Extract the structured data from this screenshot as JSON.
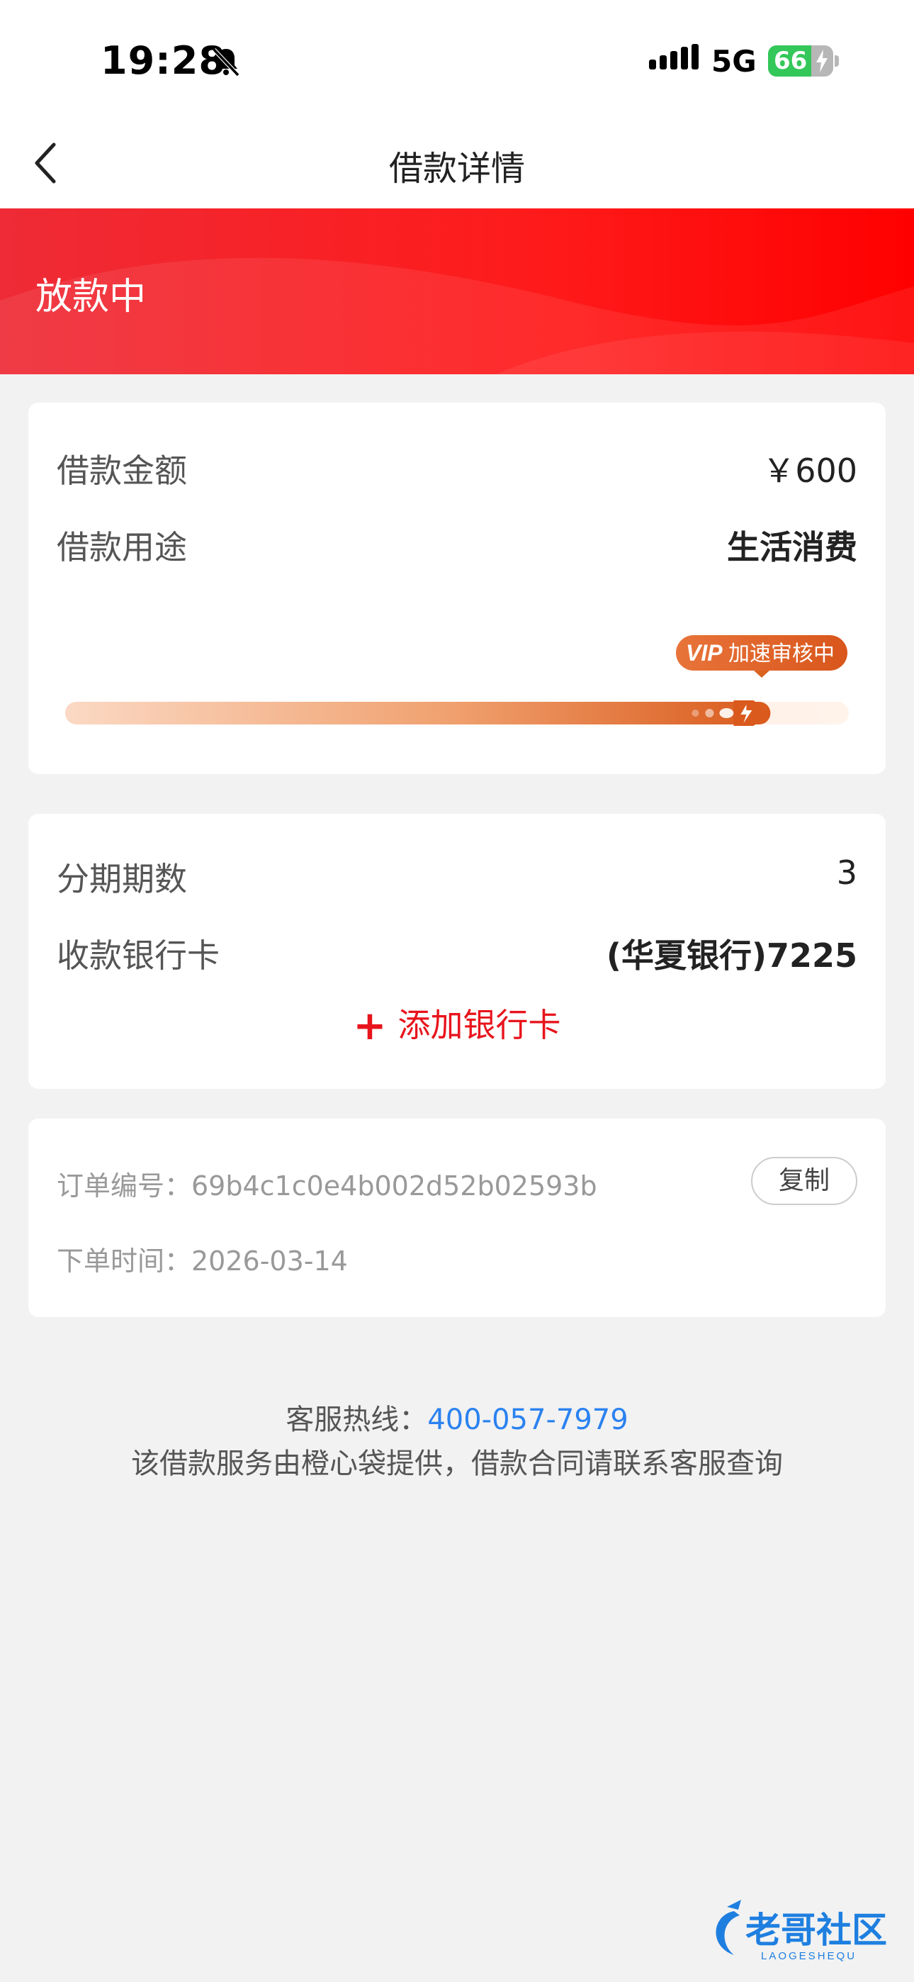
{
  "status_bar": {
    "time": "19:28",
    "network": "5G",
    "battery": "66",
    "battery_level": 0.66
  },
  "nav": {
    "title": "借款详情"
  },
  "banner": {
    "status": "放款中"
  },
  "loan_card": {
    "amount_label": "借款金额",
    "amount_value": "￥600",
    "purpose_label": "借款用途",
    "purpose_value": "生活消费",
    "vip_badge_text": "加速审核中",
    "vip_logo_text": "VIP",
    "progress_level": 0.9
  },
  "install_card": {
    "periods_label": "分期期数",
    "periods_value": "3",
    "bank_label": "收款银行卡",
    "bank_value": "(华夏银行)7225",
    "add_card_plus": "+",
    "add_card_label": "添加银行卡"
  },
  "order_card": {
    "order_no_label": "订单编号：69b4c1c0e4b002d52b02593b",
    "copy_label": "复制",
    "order_time_label": "下单时间：2026-03-14"
  },
  "footer": {
    "hotline_label": "客服热线：",
    "hotline_number": "400-057-7979",
    "note": "该借款服务由橙心袋提供，借款合同请联系客服查询"
  },
  "watermark": {
    "text": "老哥社区",
    "sub": "LAOGESHEQU"
  },
  "colors": {
    "brand_red": "#ff1a1a",
    "accent_red": "#e8141c",
    "progress_orange": "#e2691f",
    "link_blue": "#2b82f0",
    "battery_green": "#34c759"
  }
}
